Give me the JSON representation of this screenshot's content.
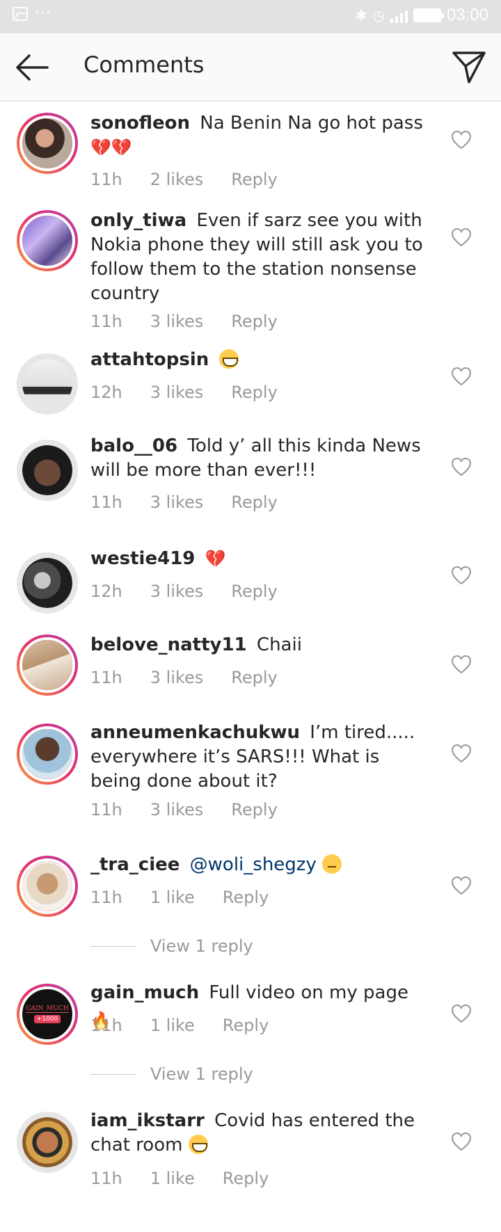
{
  "status_bar": {
    "time": "03:00",
    "dots": "···"
  },
  "header": {
    "title": "Comments"
  },
  "colors": {
    "ring_start": "#f9a23a",
    "ring_end": "#b53fa8",
    "mention": "#003569",
    "meta": "#999999"
  },
  "comments": [
    {
      "user": "sonofleon",
      "text": "Na Benin Na go hot pass",
      "emoji": "💔💔",
      "time": "11h",
      "likes": "2 likes",
      "reply": "Reply"
    },
    {
      "user": "only_tiwa",
      "text": "Even if sarz see you with Nokia phone they will still ask you to follow them to the station nonsense country",
      "time": "11h",
      "likes": "3 likes",
      "reply": "Reply"
    },
    {
      "user": "attahtopsin",
      "text": "",
      "time": "12h",
      "likes": "3 likes",
      "reply": "Reply"
    },
    {
      "user": "balo__06",
      "text": "Told y’ all this kinda News will be more than ever!!!",
      "time": "11h",
      "likes": "3 likes",
      "reply": "Reply"
    },
    {
      "user": "westie419",
      "text": "",
      "emoji": "💔",
      "time": "12h",
      "likes": "3 likes",
      "reply": "Reply"
    },
    {
      "user": "belove_natty11",
      "text": "Chaii",
      "time": "11h",
      "likes": "3 likes",
      "reply": "Reply"
    },
    {
      "user": "anneumenkachukwu",
      "text": "I’m tired..... everywhere it’s SARS!!! What is being done about it?",
      "time": "11h",
      "likes": "3 likes",
      "reply": "Reply"
    },
    {
      "user": "_tra_ciee",
      "mention": "@woli_shegzy",
      "time": "11h",
      "likes": "1 like",
      "reply": "Reply",
      "view_replies": "View 1 reply"
    },
    {
      "user": "gain_much",
      "text": "Full video on my page",
      "emoji": "🔥",
      "avatar_text": "GAIN_MUCH",
      "avatar_badge": "+1000",
      "time": "11h",
      "likes": "1 like",
      "reply": "Reply",
      "view_replies": "View 1 reply"
    },
    {
      "user": "iam_ikstarr",
      "text": "Covid has entered the chat room",
      "time": "11h",
      "likes": "1 like",
      "reply": "Reply"
    }
  ]
}
